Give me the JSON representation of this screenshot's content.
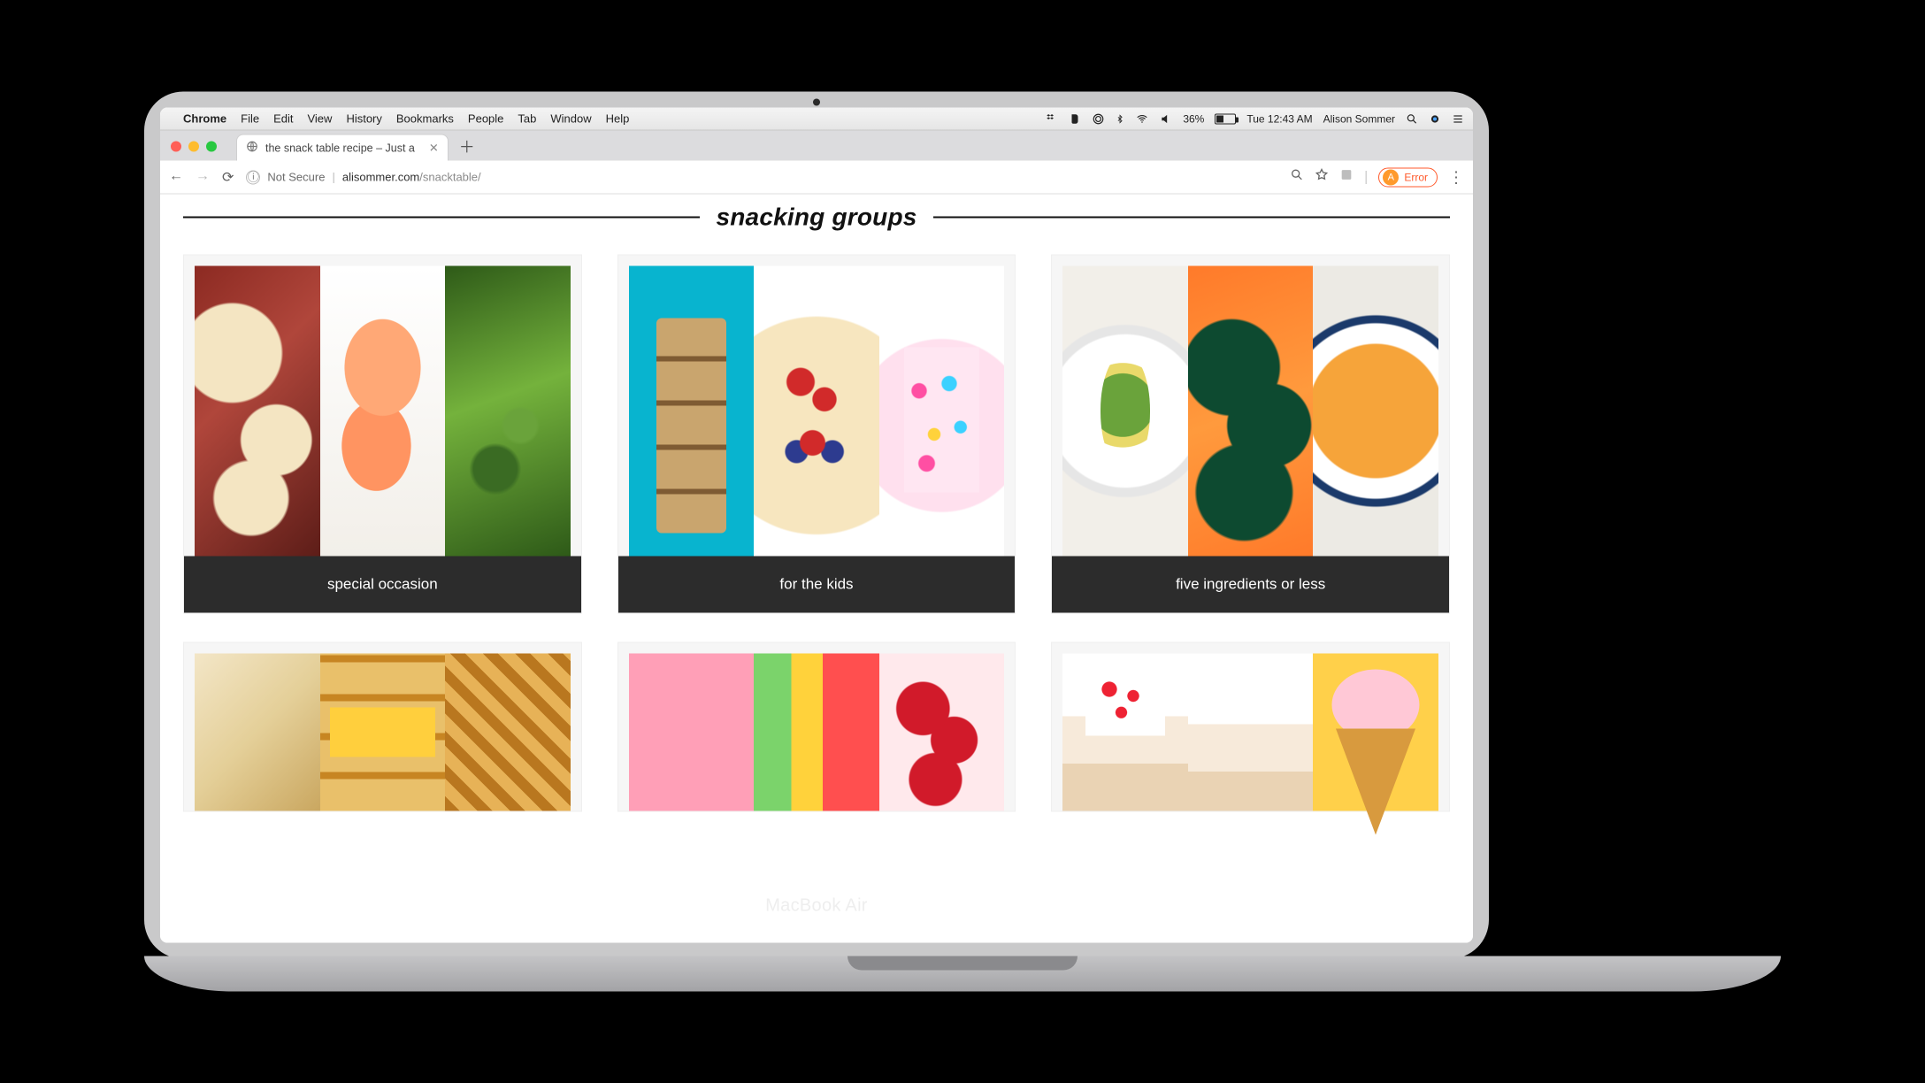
{
  "device_label": "MacBook Air",
  "menubar": {
    "app": "Chrome",
    "items": [
      "File",
      "Edit",
      "View",
      "History",
      "Bookmarks",
      "People",
      "Tab",
      "Window",
      "Help"
    ],
    "battery_pct": "36%",
    "clock": "Tue 12:43 AM",
    "user": "Alison Sommer"
  },
  "browser": {
    "tab_title": "the snack table recipe – Just a",
    "address_security": "Not Secure",
    "address_domain": "alisommer.com",
    "address_path": "/snacktable/",
    "profile_initial": "A",
    "profile_status": "Error"
  },
  "page": {
    "heading": "snacking groups",
    "cards": [
      {
        "label": "special occasion"
      },
      {
        "label": "for the kids"
      },
      {
        "label": "five ingredients or less"
      },
      {
        "label": ""
      },
      {
        "label": ""
      },
      {
        "label": ""
      }
    ]
  }
}
